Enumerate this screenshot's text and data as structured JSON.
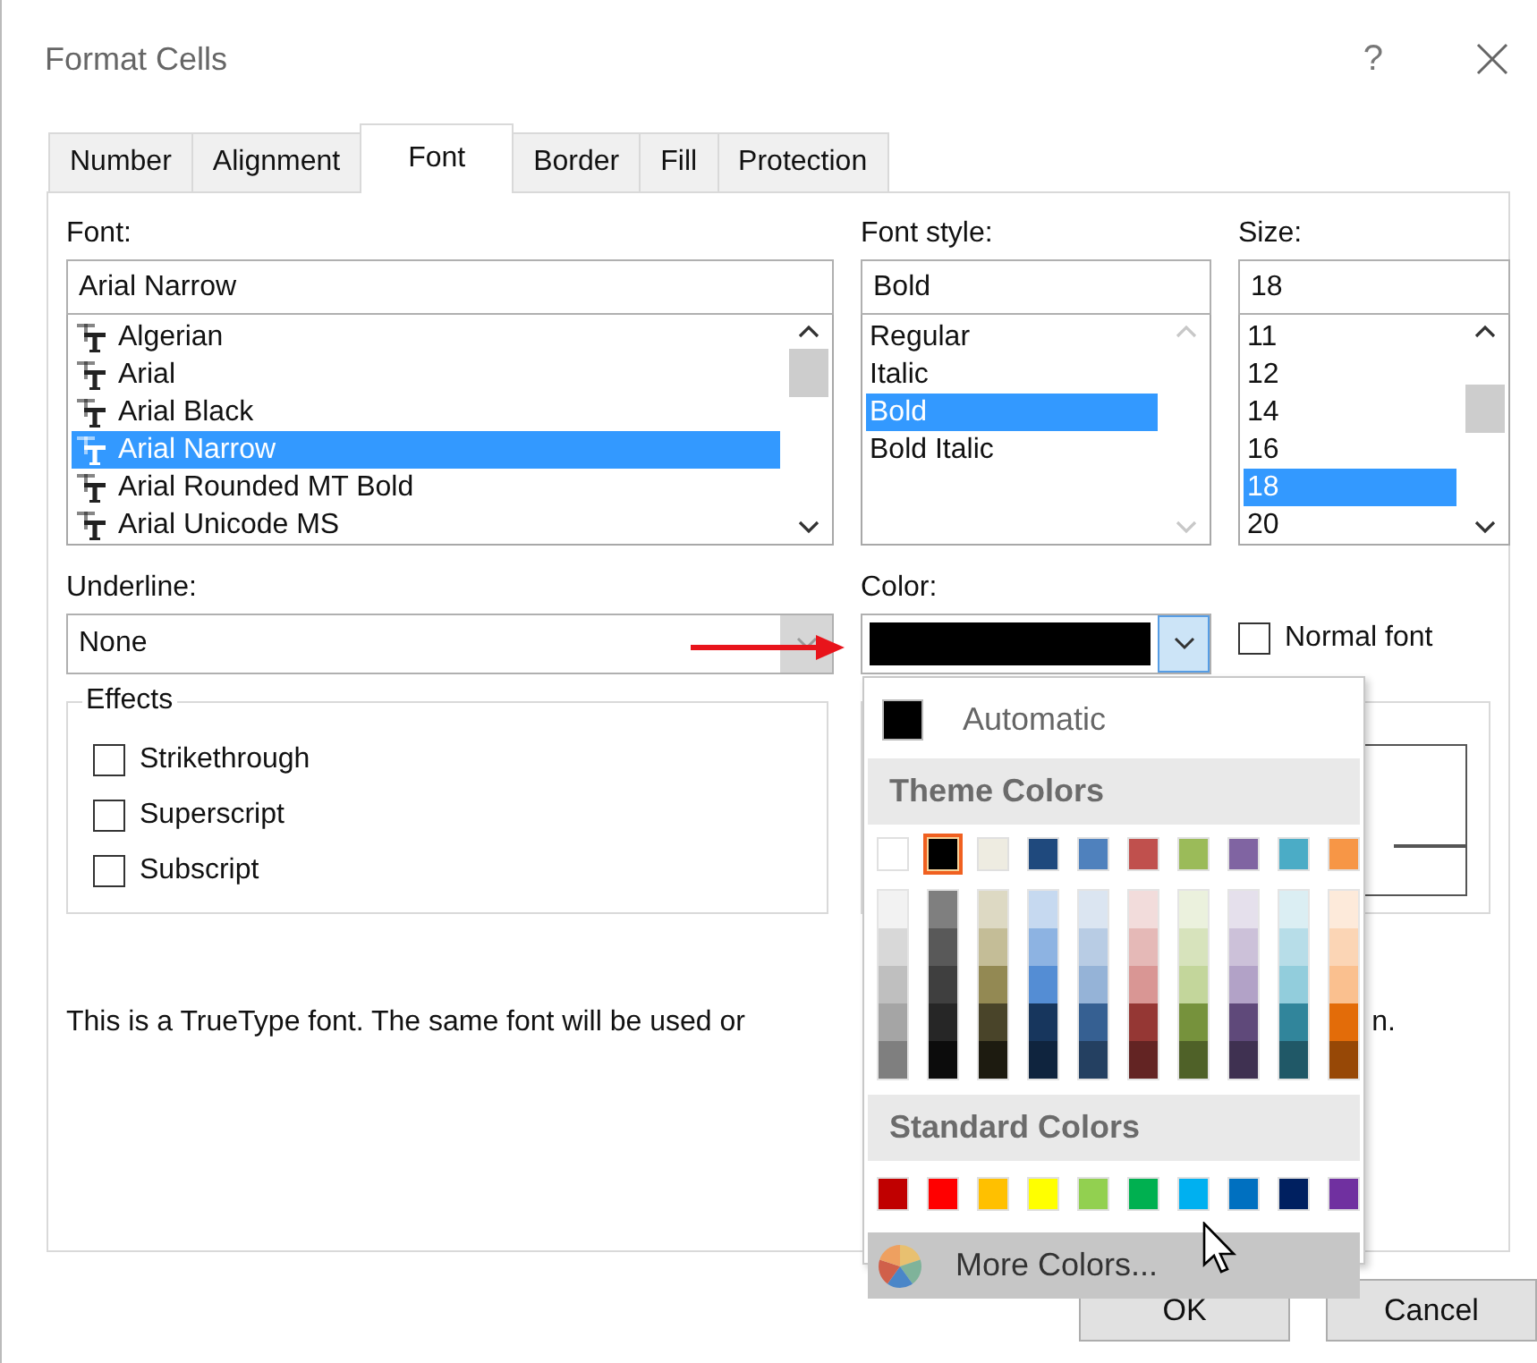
{
  "window": {
    "title": "Format Cells",
    "help": "?"
  },
  "tabs": [
    {
      "label": "Number",
      "selected": false
    },
    {
      "label": "Alignment",
      "selected": false
    },
    {
      "label": "Font",
      "selected": true
    },
    {
      "label": "Border",
      "selected": false
    },
    {
      "label": "Fill",
      "selected": false
    },
    {
      "label": "Protection",
      "selected": false
    }
  ],
  "font": {
    "label": "Font:",
    "value": "Arial Narrow",
    "items": [
      {
        "label": "Algerian",
        "selected": false
      },
      {
        "label": "Arial",
        "selected": false
      },
      {
        "label": "Arial Black",
        "selected": false
      },
      {
        "label": "Arial Narrow",
        "selected": true
      },
      {
        "label": "Arial Rounded MT Bold",
        "selected": false
      },
      {
        "label": "Arial Unicode MS",
        "selected": false
      }
    ]
  },
  "font_style": {
    "label": "Font style:",
    "value": "Bold",
    "items": [
      {
        "label": "Regular",
        "selected": false
      },
      {
        "label": "Italic",
        "selected": false
      },
      {
        "label": "Bold",
        "selected": true
      },
      {
        "label": "Bold Italic",
        "selected": false
      }
    ]
  },
  "size": {
    "label": "Size:",
    "value": "18",
    "items": [
      {
        "label": "11",
        "selected": false
      },
      {
        "label": "12",
        "selected": false
      },
      {
        "label": "14",
        "selected": false
      },
      {
        "label": "16",
        "selected": false
      },
      {
        "label": "18",
        "selected": true
      },
      {
        "label": "20",
        "selected": false
      }
    ]
  },
  "underline": {
    "label": "Underline:",
    "value": "None"
  },
  "color": {
    "label": "Color:",
    "color": "#000000",
    "expanded": true
  },
  "normal_font": {
    "label": "Normal font",
    "checked": false
  },
  "effects": {
    "title": "Effects",
    "options": [
      {
        "label": "Strikethrough",
        "checked": false
      },
      {
        "label": "Superscript",
        "checked": false
      },
      {
        "label": "Subscript",
        "checked": false
      }
    ]
  },
  "note_parts": [
    "This is a TrueType font.  The same font will be used or",
    "n."
  ],
  "color_menu": {
    "automatic": {
      "label": "Automatic",
      "color": "#000000"
    },
    "theme_title": "Theme Colors",
    "theme_colors": [
      {
        "color": "#ffffff",
        "selected": false,
        "shades": [
          {
            "color": "#f2f2f2"
          },
          {
            "color": "#d8d8d8"
          },
          {
            "color": "#bfbfbf"
          },
          {
            "color": "#a5a5a5"
          },
          {
            "color": "#7f7f7f"
          }
        ]
      },
      {
        "color": "#000000",
        "selected": true,
        "shades": [
          {
            "color": "#7f7f7f"
          },
          {
            "color": "#595959"
          },
          {
            "color": "#3f3f3f"
          },
          {
            "color": "#262626"
          },
          {
            "color": "#0c0c0c"
          }
        ]
      },
      {
        "color": "#eeece1",
        "selected": false,
        "shades": [
          {
            "color": "#ddd9c3"
          },
          {
            "color": "#c4bd97"
          },
          {
            "color": "#938953"
          },
          {
            "color": "#494429"
          },
          {
            "color": "#1d1b10"
          }
        ]
      },
      {
        "color": "#1f497d",
        "selected": false,
        "shades": [
          {
            "color": "#c6d9f0"
          },
          {
            "color": "#8db3e2"
          },
          {
            "color": "#548dd4"
          },
          {
            "color": "#17365d"
          },
          {
            "color": "#0f243e"
          }
        ]
      },
      {
        "color": "#4f81bd",
        "selected": false,
        "shades": [
          {
            "color": "#dbe5f1"
          },
          {
            "color": "#b8cce4"
          },
          {
            "color": "#95b3d7"
          },
          {
            "color": "#366092"
          },
          {
            "color": "#244061"
          }
        ]
      },
      {
        "color": "#c0504d",
        "selected": false,
        "shades": [
          {
            "color": "#f2dcdb"
          },
          {
            "color": "#e5b9b7"
          },
          {
            "color": "#d99694"
          },
          {
            "color": "#953734"
          },
          {
            "color": "#632423"
          }
        ]
      },
      {
        "color": "#9bbb59",
        "selected": false,
        "shades": [
          {
            "color": "#ebf1dd"
          },
          {
            "color": "#d7e3bc"
          },
          {
            "color": "#c3d69b"
          },
          {
            "color": "#76923c"
          },
          {
            "color": "#4f6128"
          }
        ]
      },
      {
        "color": "#8064a2",
        "selected": false,
        "shades": [
          {
            "color": "#e5e0ec"
          },
          {
            "color": "#ccc1d9"
          },
          {
            "color": "#b2a2c7"
          },
          {
            "color": "#5f497a"
          },
          {
            "color": "#3f3151"
          }
        ]
      },
      {
        "color": "#4bacc6",
        "selected": false,
        "shades": [
          {
            "color": "#dbeef3"
          },
          {
            "color": "#b7dde8"
          },
          {
            "color": "#92cddc"
          },
          {
            "color": "#31859b"
          },
          {
            "color": "#205867"
          }
        ]
      },
      {
        "color": "#f79646",
        "selected": false,
        "shades": [
          {
            "color": "#fdeada"
          },
          {
            "color": "#fbd5b5"
          },
          {
            "color": "#fac08f"
          },
          {
            "color": "#e36c09"
          },
          {
            "color": "#974806"
          }
        ]
      }
    ],
    "standard_title": "Standard Colors",
    "standard_colors": [
      {
        "color": "#c00000"
      },
      {
        "color": "#ff0000"
      },
      {
        "color": "#ffc000"
      },
      {
        "color": "#ffff00"
      },
      {
        "color": "#92d050"
      },
      {
        "color": "#00b050"
      },
      {
        "color": "#00b0f0"
      },
      {
        "color": "#0070c0"
      },
      {
        "color": "#002060"
      },
      {
        "color": "#7030a0"
      }
    ],
    "more": {
      "label": "More Colors...",
      "highlighted": true
    }
  },
  "buttons": [
    {
      "label": "OK"
    },
    {
      "label": "Cancel"
    }
  ]
}
